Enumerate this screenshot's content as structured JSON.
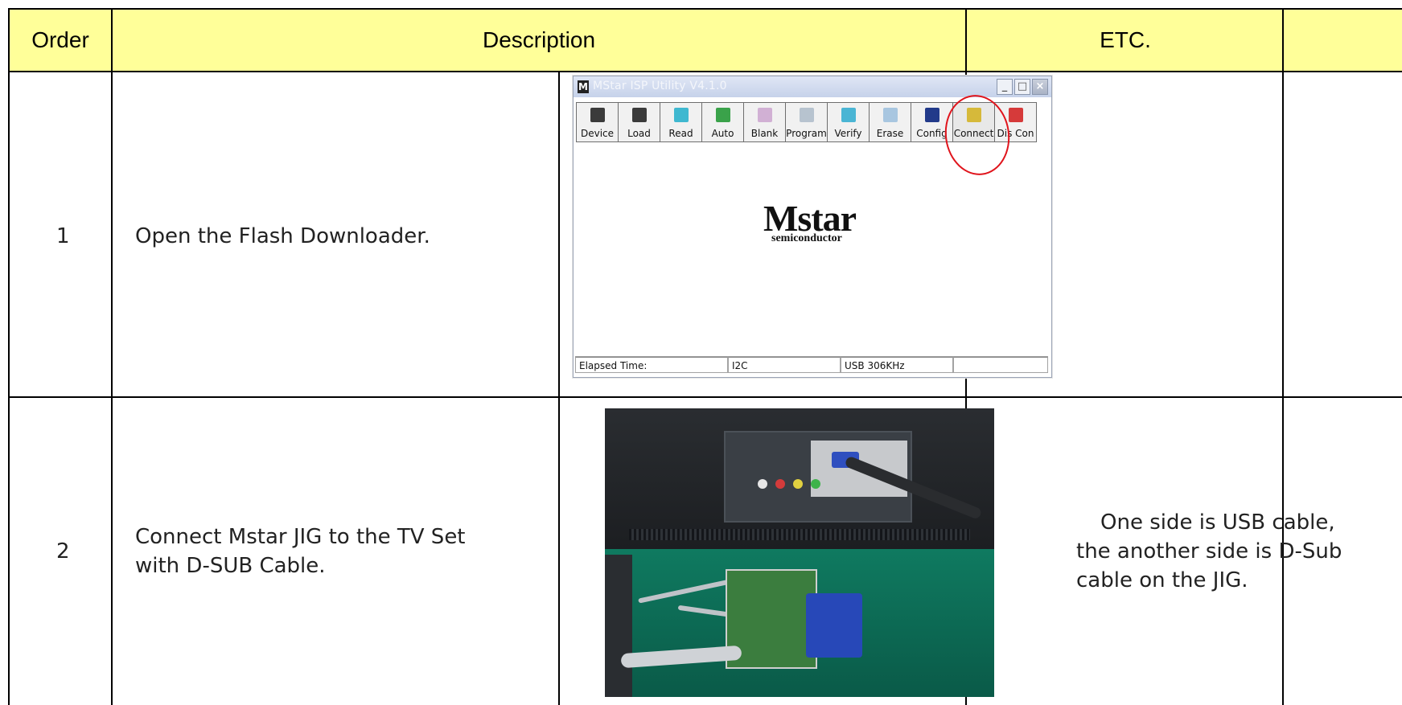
{
  "header": {
    "order": "Order",
    "description": "Description",
    "etc": "ETC."
  },
  "rows": [
    {
      "order": "1",
      "text": "Open the Flash Downloader.",
      "etc": ""
    },
    {
      "order": "2",
      "text_line1": "Connect Mstar JIG to the TV Set",
      "text_line2": "with D-SUB Cable.",
      "etc_line1": "One side is USB cable,",
      "etc_line2": "the another side is D-Sub",
      "etc_line3": "cable on the JIG."
    }
  ],
  "isp_window": {
    "title": "MStar ISP Utility V4.1.0",
    "toolbar": [
      "Device",
      "Load",
      "Read",
      "Auto",
      "Blank",
      "Program",
      "Verify",
      "Erase",
      "Config",
      "Connect",
      "Dis Con"
    ],
    "logo_word": "Mstar",
    "logo_sub": "semiconductor",
    "status": {
      "elapsed": "Elapsed Time:",
      "bus": "I2C",
      "usb": "USB  306KHz"
    }
  },
  "colors": {
    "header_bg": "#ffff99",
    "highlight": "#e0141c",
    "logo_accent": "#c8192a"
  }
}
